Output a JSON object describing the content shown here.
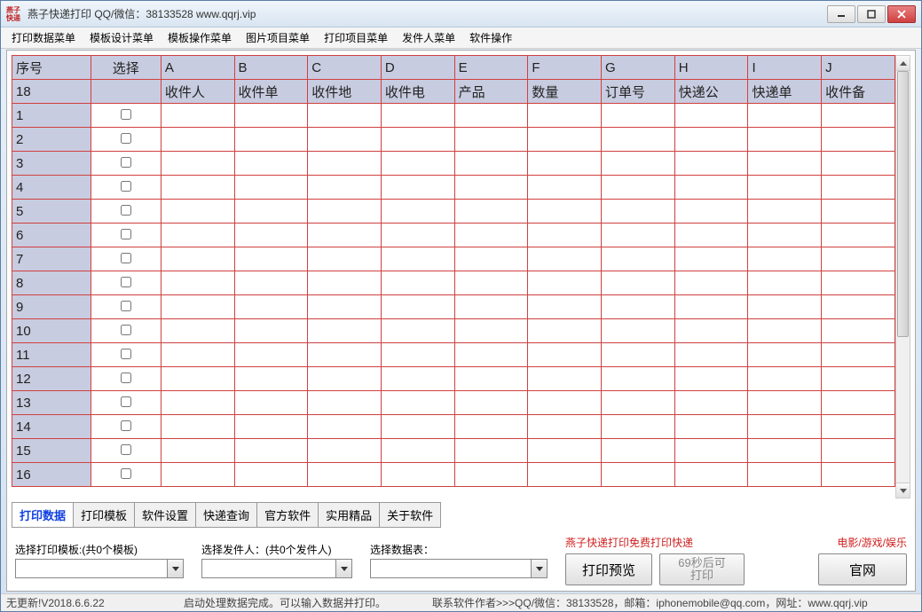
{
  "title": "燕子快递打印    QQ/微信：38133528    www.qqrj.vip",
  "icon_text": "燕子\n快递",
  "menubar": [
    "打印数据菜单",
    "模板设计菜单",
    "模板操作菜单",
    "图片项目菜单",
    "打印项目菜单",
    "发件人菜单",
    "软件操作"
  ],
  "grid": {
    "headers1": [
      "序号",
      "选择",
      "A",
      "B",
      "C",
      "D",
      "E",
      "F",
      "G",
      "H",
      "I",
      "J"
    ],
    "headers2_first": "18",
    "headers2": [
      "",
      "收件人",
      "收件单",
      "收件地",
      "收件电",
      "产品",
      "数量",
      "订单号",
      "快递公",
      "快递单",
      "收件备"
    ],
    "row_count": 16,
    "checkbox_state": false
  },
  "tabs": [
    "打印数据",
    "打印模板",
    "软件设置",
    "快递查询",
    "官方软件",
    "实用精品",
    "关于软件"
  ],
  "active_tab_index": 0,
  "combos": {
    "template_label": "选择打印模板:(共0个模板)",
    "sender_label": "选择发件人：(共0个发件人)",
    "datatable_label": "选择数据表："
  },
  "red_promo": "燕子快递打印免费打印快递",
  "print_preview_btn": "打印预览",
  "countdown_btn": "69秒后可打印",
  "entertainment_link": "电影/游戏/娱乐",
  "official_btn": "官网",
  "statusbar": {
    "left": "无更新!V2018.6.6.22",
    "mid": "启动处理数据完成。可以输入数据并打印。",
    "right": "联系软件作者>>>QQ/微信：38133528，邮箱：iphonemobile@qq.com，网址：www.qqrj.vip"
  }
}
